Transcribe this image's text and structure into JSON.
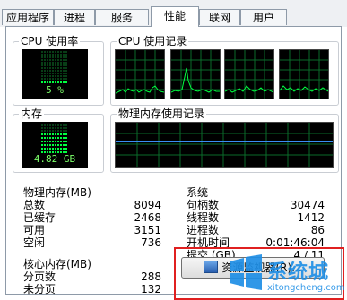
{
  "tabs": [
    "应用程序",
    "进程",
    "服务",
    "性能",
    "联网",
    "用户"
  ],
  "active_tab": "性能",
  "cpu_usage": {
    "title": "CPU 使用率",
    "value": "5 %"
  },
  "cpu_history": {
    "title": "CPU 使用记录"
  },
  "memory": {
    "title": "内存",
    "value": "4.82 GB"
  },
  "mem_history": {
    "title": "物理内存使用记录"
  },
  "physical_memory": {
    "title": "物理内存(MB)",
    "rows": [
      {
        "label": "总数",
        "value": "8094"
      },
      {
        "label": "已缓存",
        "value": "2468"
      },
      {
        "label": "可用",
        "value": "3151"
      },
      {
        "label": "空闲",
        "value": "736"
      }
    ]
  },
  "kernel_memory": {
    "title": "核心内存(MB)",
    "rows": [
      {
        "label": "分页数",
        "value": "288"
      },
      {
        "label": "未分页",
        "value": "132"
      }
    ]
  },
  "system": {
    "title": "系统",
    "rows": [
      {
        "label": "句柄数",
        "value": "30474"
      },
      {
        "label": "线程数",
        "value": "1412"
      },
      {
        "label": "进程数",
        "value": "86"
      },
      {
        "label": "开机时间",
        "value": "0:01:46:04"
      },
      {
        "label": "提交 (GB)",
        "value": "4 / 11"
      }
    ]
  },
  "resource_monitor_button": {
    "label": "资源监视器(R)..."
  },
  "watermark": {
    "brand": "系统城",
    "url": "xitongcheng.com"
  },
  "colors": {
    "graph_green": "#00ff40",
    "graph_grid": "#0a6a2a",
    "mem_line": "#3a8ef5",
    "highlight": "#e02020"
  }
}
